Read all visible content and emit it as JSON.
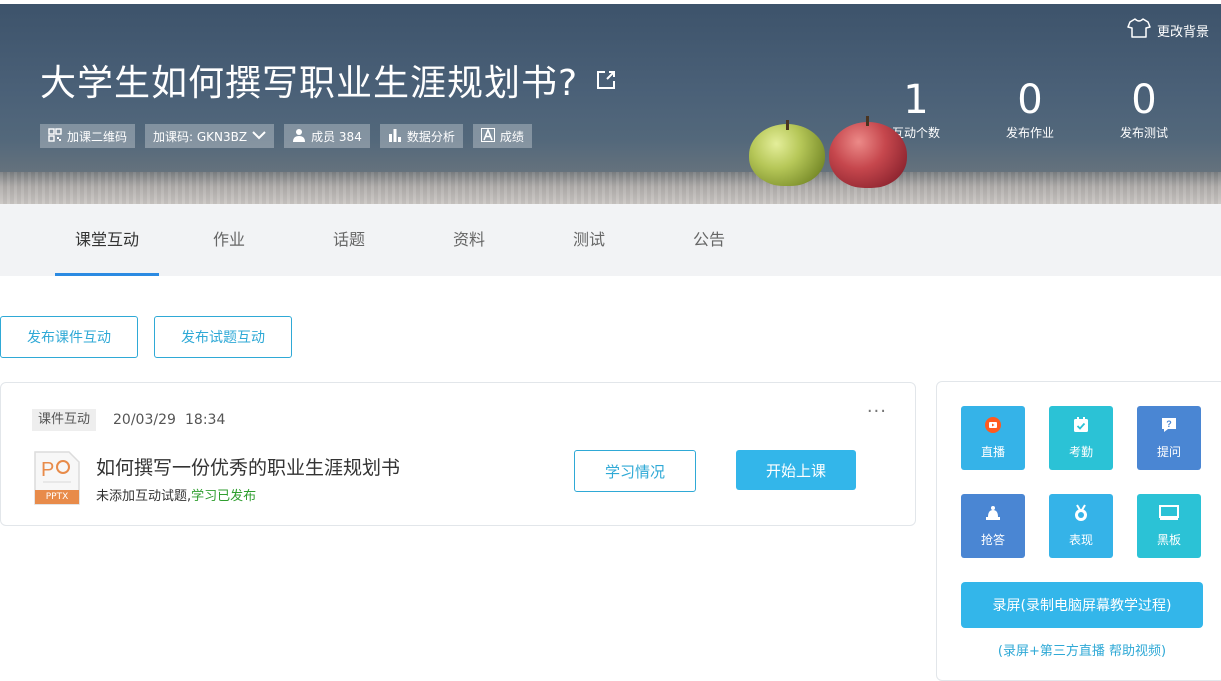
{
  "banner": {
    "change_bg_label": "更改背景",
    "title": "大学生如何撰写职业生涯规划书?",
    "chips": {
      "qr": "加课二维码",
      "code": "加课码: GKN3BZ",
      "members": "成员 384",
      "analysis": "数据分析",
      "grades": "成绩"
    },
    "stats": [
      {
        "value": "1",
        "label": "互动个数"
      },
      {
        "value": "0",
        "label": "发布作业"
      },
      {
        "value": "0",
        "label": "发布测试"
      }
    ]
  },
  "tabs": [
    "课堂互动",
    "作业",
    "话题",
    "资料",
    "测试",
    "公告"
  ],
  "actions": {
    "publish_courseware": "发布课件互动",
    "publish_quiz": "发布试题互动"
  },
  "card": {
    "tag": "课件互动",
    "date": "20/03/29",
    "time": "18:34",
    "more": "···",
    "file_type": "PPTX",
    "title": "如何撰写一份优秀的职业生涯规划书",
    "sub_prefix": "未添加互动试题,",
    "sub_status": "学习已发布",
    "study_button": "学习情况",
    "start_button": "开始上课"
  },
  "side": {
    "tools": [
      {
        "label": "直播",
        "icon": "live-icon",
        "color": "#35b3e8"
      },
      {
        "label": "考勤",
        "icon": "attendance-icon",
        "color": "#2bc2d6"
      },
      {
        "label": "提问",
        "icon": "question-icon",
        "color": "#4a86d3"
      },
      {
        "label": "抢答",
        "icon": "buzzer-icon",
        "color": "#4a86d3"
      },
      {
        "label": "表现",
        "icon": "medal-icon",
        "color": "#35b3e8"
      },
      {
        "label": "黑板",
        "icon": "blackboard-icon",
        "color": "#2bc2d6"
      }
    ],
    "record_button": "录屏(录制电脑屏幕教学过程)",
    "help_link": "(录屏+第三方直播 帮助视频)"
  }
}
